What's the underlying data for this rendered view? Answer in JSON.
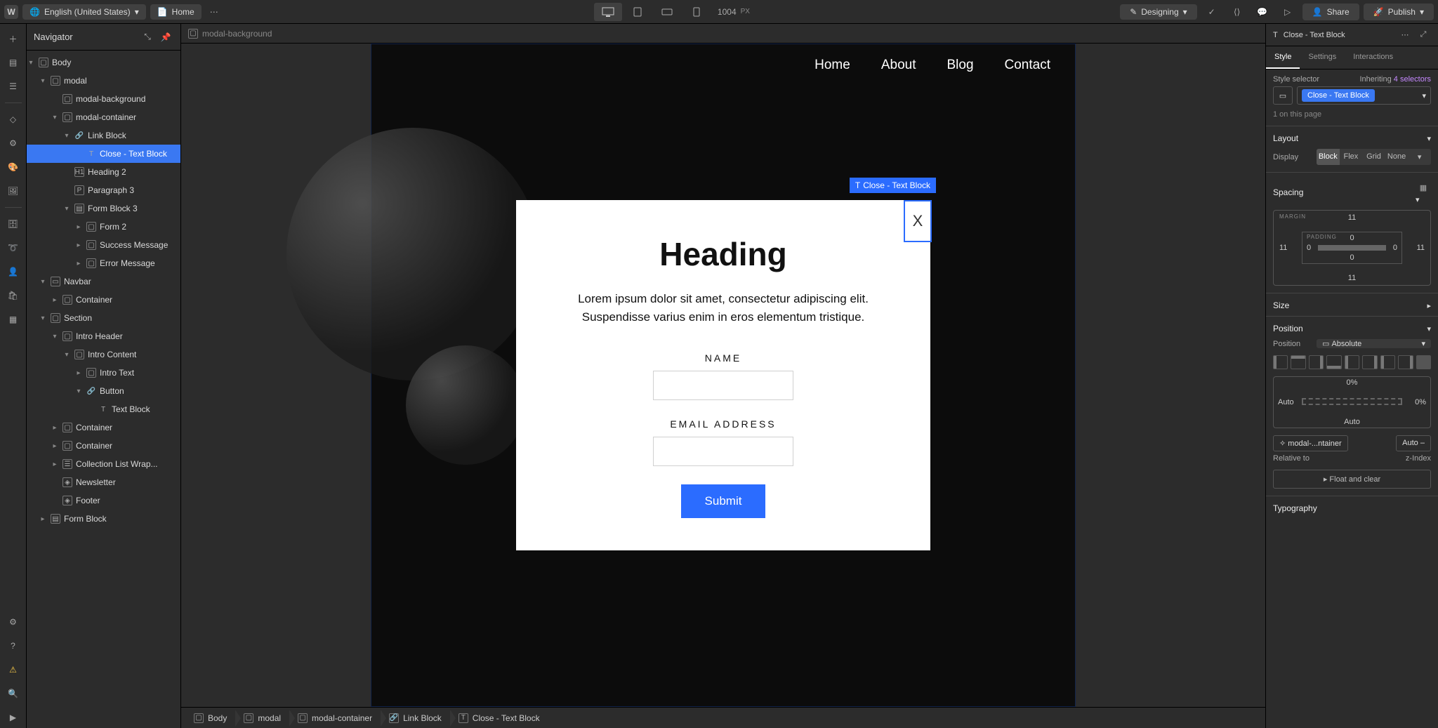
{
  "locale": "English (United States)",
  "page": "Home",
  "canvasWidth": "1004",
  "canvasUnit": "PX",
  "mode": "Designing",
  "share": "Share",
  "publish": "Publish",
  "navigator": {
    "title": "Navigator",
    "tree": [
      {
        "depth": 0,
        "twisty": "down",
        "icon": "div",
        "label": "Body"
      },
      {
        "depth": 1,
        "twisty": "down",
        "icon": "div",
        "label": "modal"
      },
      {
        "depth": 2,
        "twisty": "none",
        "icon": "div",
        "label": "modal-background"
      },
      {
        "depth": 2,
        "twisty": "down",
        "icon": "div",
        "label": "modal-container"
      },
      {
        "depth": 3,
        "twisty": "down",
        "icon": "link",
        "label": "Link Block"
      },
      {
        "depth": 4,
        "twisty": "none",
        "icon": "text",
        "label": "Close - Text Block",
        "selected": true
      },
      {
        "depth": 3,
        "twisty": "none",
        "icon": "h",
        "label": "Heading 2"
      },
      {
        "depth": 3,
        "twisty": "none",
        "icon": "p",
        "label": "Paragraph 3"
      },
      {
        "depth": 3,
        "twisty": "down",
        "icon": "form",
        "label": "Form Block 3"
      },
      {
        "depth": 4,
        "twisty": "right",
        "icon": "div",
        "label": "Form 2"
      },
      {
        "depth": 4,
        "twisty": "right",
        "icon": "div",
        "label": "Success Message"
      },
      {
        "depth": 4,
        "twisty": "right",
        "icon": "div",
        "label": "Error Message"
      },
      {
        "depth": 1,
        "twisty": "down",
        "icon": "nav",
        "label": "Navbar"
      },
      {
        "depth": 2,
        "twisty": "right",
        "icon": "div",
        "label": "Container"
      },
      {
        "depth": 1,
        "twisty": "down",
        "icon": "div",
        "label": "Section"
      },
      {
        "depth": 2,
        "twisty": "down",
        "icon": "div",
        "label": "Intro Header"
      },
      {
        "depth": 3,
        "twisty": "down",
        "icon": "div",
        "label": "Intro Content"
      },
      {
        "depth": 4,
        "twisty": "right",
        "icon": "div",
        "label": "Intro Text"
      },
      {
        "depth": 4,
        "twisty": "down",
        "icon": "link",
        "label": "Button"
      },
      {
        "depth": 5,
        "twisty": "none",
        "icon": "text",
        "label": "Text Block"
      },
      {
        "depth": 2,
        "twisty": "right",
        "icon": "div",
        "label": "Container"
      },
      {
        "depth": 2,
        "twisty": "right",
        "icon": "div",
        "label": "Container"
      },
      {
        "depth": 2,
        "twisty": "right",
        "icon": "coll",
        "label": "Collection List Wrap..."
      },
      {
        "depth": 2,
        "twisty": "none",
        "icon": "sec",
        "label": "Newsletter"
      },
      {
        "depth": 2,
        "twisty": "none",
        "icon": "sec",
        "label": "Footer"
      },
      {
        "depth": 1,
        "twisty": "right",
        "icon": "form",
        "label": "Form Block"
      }
    ]
  },
  "canvasCrumbTop": "modal-background",
  "siteNav": [
    "Home",
    "About",
    "Blog",
    "Contact"
  ],
  "modal": {
    "heading": "Heading",
    "para": "Lorem ipsum dolor sit amet, consectetur adipiscing elit. Suspendisse varius enim in eros elementum tristique.",
    "nameLabel": "NAME",
    "emailLabel": "EMAIL ADDRESS",
    "submit": "Submit",
    "closeLabel": "Close - Text Block",
    "closeGlyph": "X"
  },
  "crumbs": [
    "Body",
    "modal",
    "modal-container",
    "Link Block",
    "Close - Text Block"
  ],
  "crumbIcons": [
    "div",
    "div",
    "div",
    "link",
    "text"
  ],
  "inspector": {
    "element": "Close - Text Block",
    "tabs": {
      "style": "Style",
      "settings": "Settings",
      "interactions": "Interactions"
    },
    "selectorLabel": "Style selector",
    "inheriting": "Inheriting",
    "inheritCount": "4 selectors",
    "classChip": "Close - Text Block",
    "usageHint": "1 on this page",
    "sections": {
      "layout": "Layout",
      "display": "Display",
      "displayOpts": [
        "Block",
        "Flex",
        "Grid",
        "None"
      ],
      "spacing": "Spacing",
      "marginLabel": "MARGIN",
      "paddingLabel": "PADDING",
      "margin": {
        "top": "11",
        "right": "11",
        "bottom": "11",
        "left": "11"
      },
      "padding": {
        "top": "0",
        "right": "0",
        "bottom": "0",
        "left": "0"
      },
      "size": "Size",
      "position": "Position",
      "positionLabel": "Position",
      "positionValue": "Absolute",
      "pos": {
        "top": "0%",
        "right": "0%",
        "bottom": "Auto",
        "left": "Auto"
      },
      "relativeTo": "Relative to",
      "relativeValue": "modal-...ntainer",
      "zindexLabel": "z-Index",
      "zindexValue": "Auto",
      "floatClear": "Float and clear",
      "typography": "Typography"
    }
  }
}
